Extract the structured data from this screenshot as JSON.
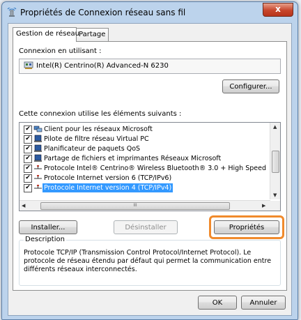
{
  "window": {
    "title": "Propriétés de Connexion réseau sans fil",
    "close_label": "x"
  },
  "tabs": [
    {
      "label": "Gestion de réseau",
      "active": true
    },
    {
      "label": "Partage",
      "active": false
    }
  ],
  "connection": {
    "label": "Connexion en utilisant :",
    "adapter": "Intel(R) Centrino(R) Advanced-N 6230",
    "configure_button": "Configurer..."
  },
  "components": {
    "label": "Cette connexion utilise les éléments suivants :",
    "items": [
      {
        "label": "Client pour les réseaux Microsoft",
        "checked": true,
        "icon": "network-client-icon",
        "selected": false
      },
      {
        "label": "Pilote de filtre réseau Virtual PC",
        "checked": true,
        "icon": "service-icon",
        "selected": false
      },
      {
        "label": "Planificateur de paquets QoS",
        "checked": true,
        "icon": "service-icon",
        "selected": false
      },
      {
        "label": "Partage de fichiers et imprimantes Réseaux Microsoft",
        "checked": true,
        "icon": "service-icon",
        "selected": false
      },
      {
        "label": "Protocole Intel® Centrino® Wireless Bluetooth® 3.0 + High Speed",
        "checked": true,
        "icon": "protocol-icon",
        "selected": false
      },
      {
        "label": "Protocole Internet version 6 (TCP/IPv6)",
        "checked": true,
        "icon": "protocol-icon",
        "selected": false
      },
      {
        "label": "Protocole Internet version 4 (TCP/IPv4)",
        "checked": true,
        "icon": "protocol-icon",
        "selected": true
      }
    ],
    "check_mark": "✔",
    "scroll_thumb_grip": "III"
  },
  "actions": {
    "install": "Installer...",
    "uninstall": "Désinstaller",
    "properties": "Propriétés"
  },
  "description": {
    "title": "Description",
    "text": "Protocole TCP/IP (Transmission Control Protocol/Internet Protocol). Le protocole de réseau étendu par défaut qui permet la communication entre différents réseaux interconnectés."
  },
  "footer": {
    "ok": "OK",
    "cancel": "Annuler"
  },
  "colors": {
    "highlight": "#f08a2c",
    "selection": "#3399ff"
  }
}
